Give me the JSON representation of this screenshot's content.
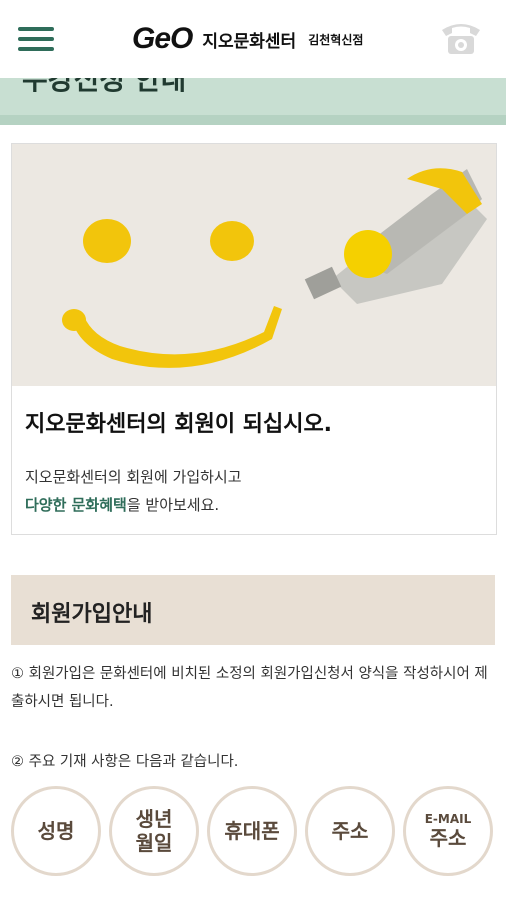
{
  "header": {
    "logo_text": "GeO",
    "brand_name": "지오문화센터",
    "branch_name": "김천혁신점",
    "menu_icon": "hamburger-menu-icon",
    "phone_icon": "telephone-icon",
    "accent_color": "#2f6d5a"
  },
  "title_band": {
    "text": "수강신청 안내",
    "color": "#c8dfd2"
  },
  "card": {
    "image_icon": "yellow-smiley-paint-illustration",
    "heading": "지오문화센터의 회원이 되십시오.",
    "line1": "지오문화센터의 회원에 가입하시고",
    "line2_highlight": "다양한 문화혜택",
    "line2_rest": "을 받아보세요."
  },
  "section": {
    "title": "회원가입안내",
    "para1": "① 회원가입은 문화센터에 비치된 소정의 회원가입신청서 양식을 작성하시어 제출하시면 됩니다.",
    "para2": "② 주요 기재 사항은 다음과 같습니다."
  },
  "items": [
    {
      "label": "성명"
    },
    {
      "label": "생년\n월일"
    },
    {
      "label": "휴대폰"
    },
    {
      "label": "주소"
    },
    {
      "sub": "E-MAIL",
      "label": "주소"
    }
  ]
}
